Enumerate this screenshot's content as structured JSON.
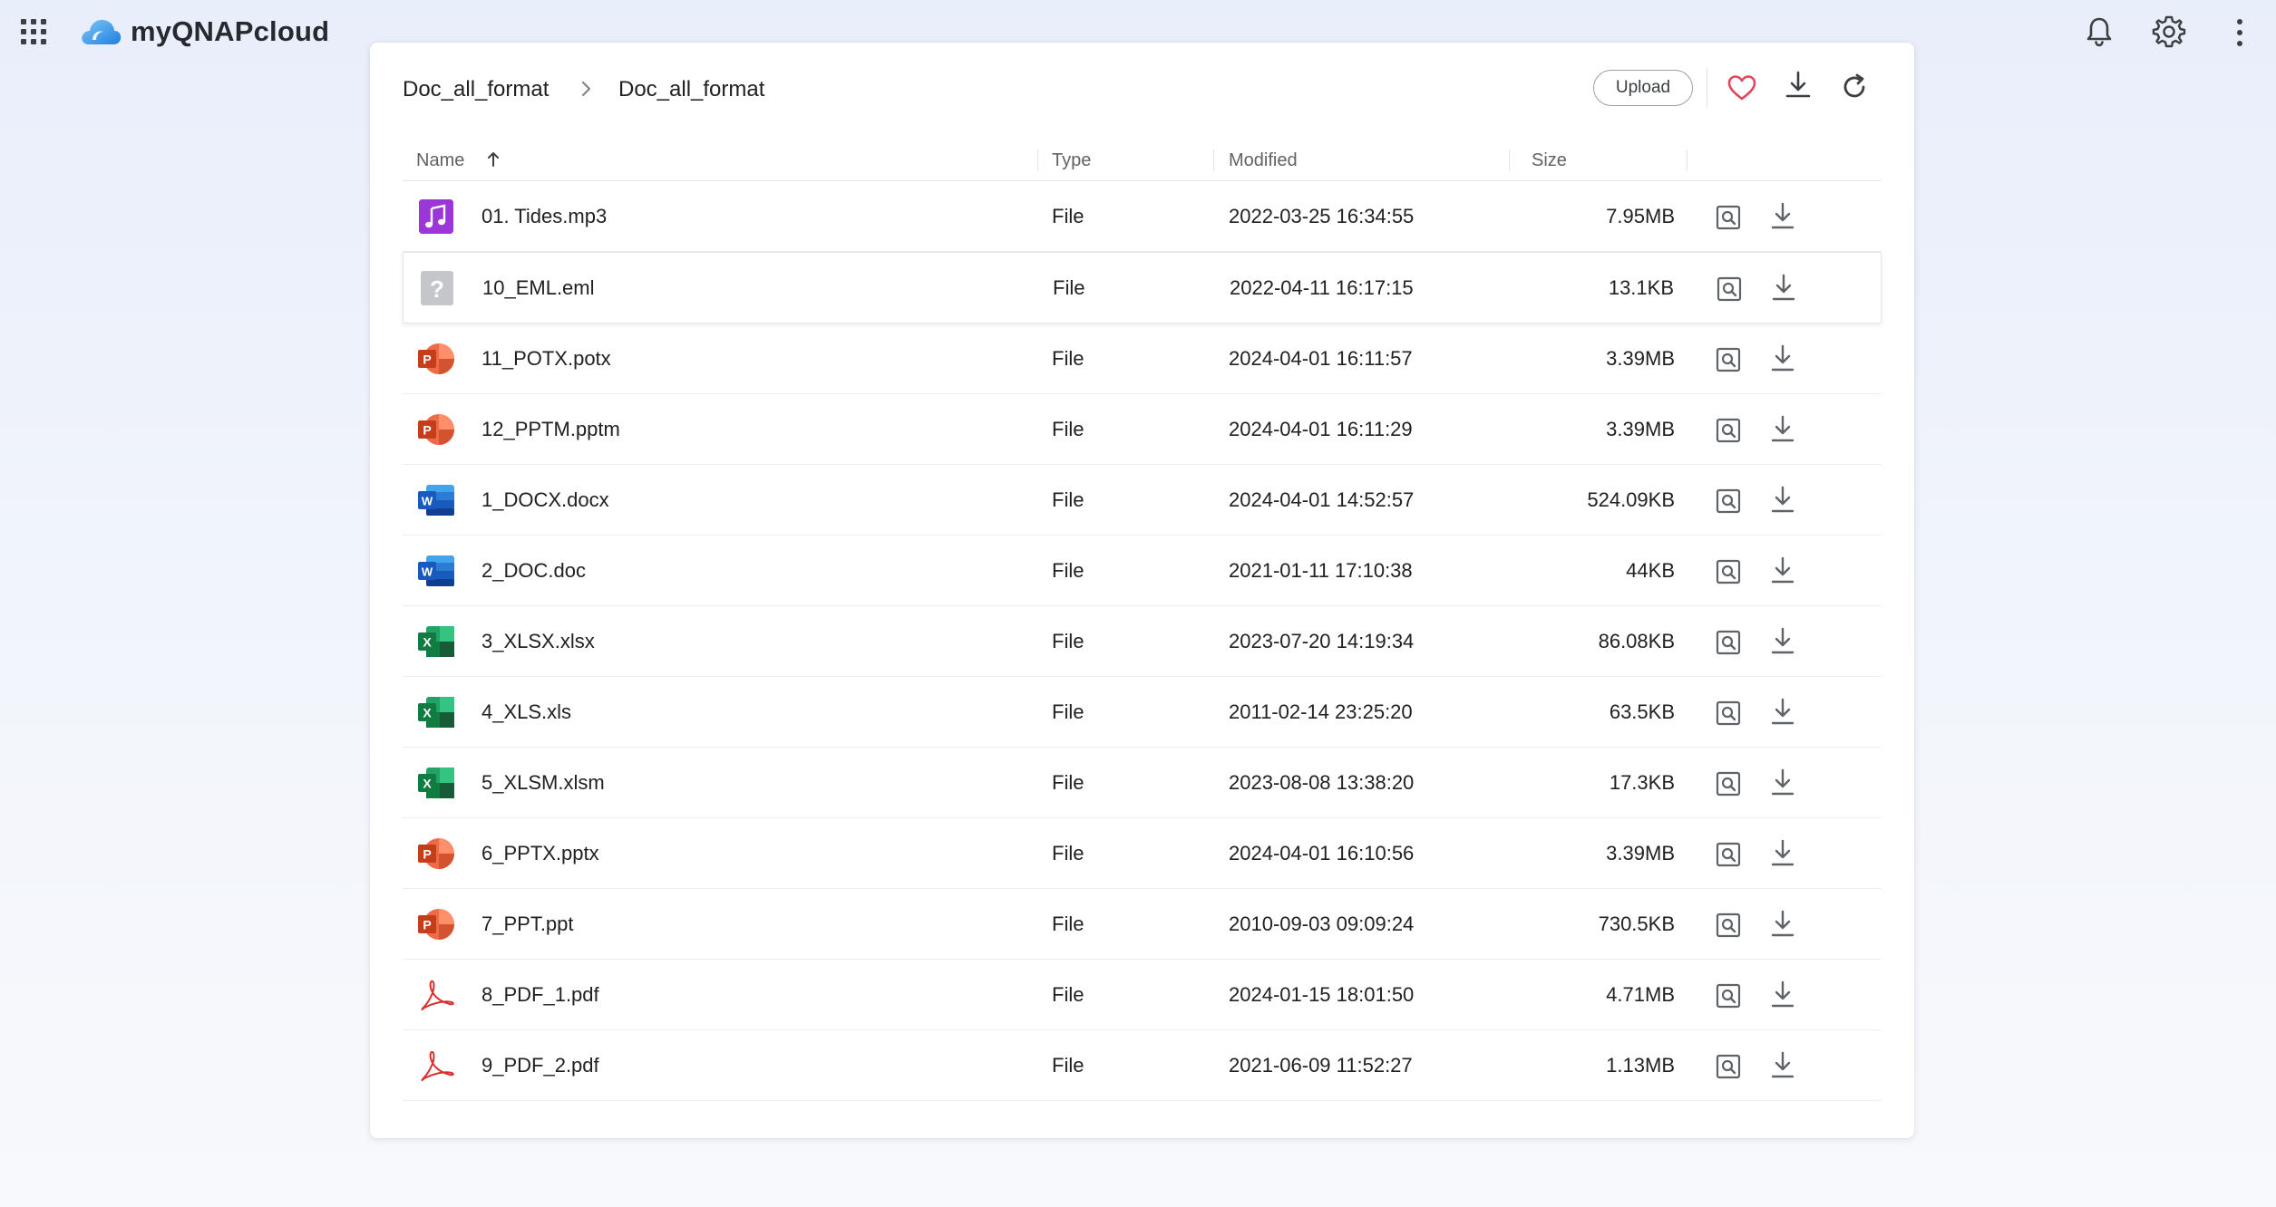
{
  "app": {
    "brand": "myQNAPcloud",
    "colors": {
      "accent": "#2f8fe8",
      "favorite": "#e0475b",
      "text": "#202124",
      "muted": "#5f6368"
    }
  },
  "breadcrumb": {
    "items": [
      "Doc_all_format",
      "Doc_all_format"
    ]
  },
  "toolbar": {
    "upload_label": "Upload"
  },
  "table": {
    "columns": {
      "name": "Name",
      "type": "Type",
      "modified": "Modified",
      "size": "Size"
    },
    "sort": {
      "column": "Name",
      "direction": "ascending"
    },
    "rows": [
      {
        "icon": "audio-file-icon",
        "name": "01. Tides.mp3",
        "type": "File",
        "modified": "2022-03-25 16:34:55",
        "size": "7.95MB"
      },
      {
        "icon": "unknown-file-icon",
        "name": "10_EML.eml",
        "type": "File",
        "modified": "2022-04-11 16:17:15",
        "size": "13.1KB"
      },
      {
        "icon": "powerpoint-file-icon",
        "name": "11_POTX.potx",
        "type": "File",
        "modified": "2024-04-01 16:11:57",
        "size": "3.39MB"
      },
      {
        "icon": "powerpoint-file-icon",
        "name": "12_PPTM.pptm",
        "type": "File",
        "modified": "2024-04-01 16:11:29",
        "size": "3.39MB"
      },
      {
        "icon": "word-file-icon",
        "name": "1_DOCX.docx",
        "type": "File",
        "modified": "2024-04-01 14:52:57",
        "size": "524.09KB"
      },
      {
        "icon": "word-file-icon",
        "name": "2_DOC.doc",
        "type": "File",
        "modified": "2021-01-11 17:10:38",
        "size": "44KB"
      },
      {
        "icon": "excel-file-icon",
        "name": "3_XLSX.xlsx",
        "type": "File",
        "modified": "2023-07-20 14:19:34",
        "size": "86.08KB"
      },
      {
        "icon": "excel-file-icon",
        "name": "4_XLS.xls",
        "type": "File",
        "modified": "2011-02-14 23:25:20",
        "size": "63.5KB"
      },
      {
        "icon": "excel-file-icon",
        "name": "5_XLSM.xlsm",
        "type": "File",
        "modified": "2023-08-08 13:38:20",
        "size": "17.3KB"
      },
      {
        "icon": "powerpoint-file-icon",
        "name": "6_PPTX.pptx",
        "type": "File",
        "modified": "2024-04-01 16:10:56",
        "size": "3.39MB"
      },
      {
        "icon": "powerpoint-file-icon",
        "name": "7_PPT.ppt",
        "type": "File",
        "modified": "2010-09-03 09:09:24",
        "size": "730.5KB"
      },
      {
        "icon": "pdf-file-icon",
        "name": "8_PDF_1.pdf",
        "type": "File",
        "modified": "2024-01-15 18:01:50",
        "size": "4.71MB"
      },
      {
        "icon": "pdf-file-icon",
        "name": "9_PDF_2.pdf",
        "type": "File",
        "modified": "2021-06-09 11:52:27",
        "size": "1.13MB"
      }
    ]
  }
}
